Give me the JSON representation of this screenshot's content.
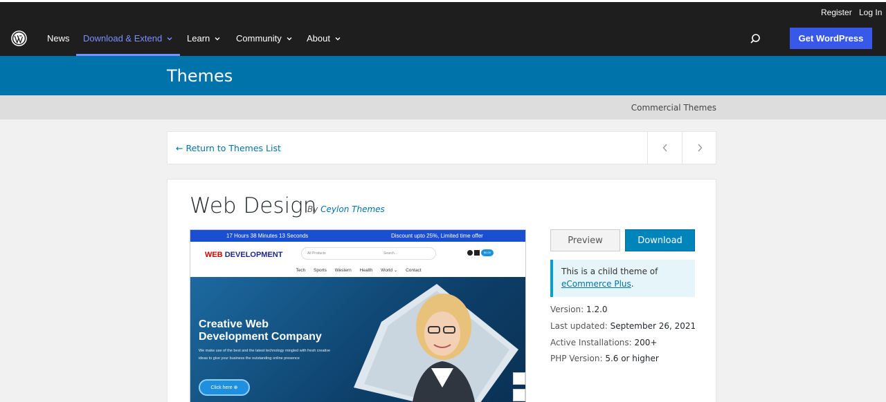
{
  "topbar": {
    "register": "Register",
    "login": "Log In"
  },
  "nav": {
    "items": [
      {
        "label": "News"
      },
      {
        "label": "Download & Extend"
      },
      {
        "label": "Learn"
      },
      {
        "label": "Community"
      },
      {
        "label": "About"
      }
    ],
    "cta": "Get WordPress",
    "accent_color": "#7b90ff",
    "cta_color": "#3858e9"
  },
  "header": {
    "title": "Themes",
    "band_color": "#0073aa"
  },
  "subnav": {
    "commercial": "Commercial Themes"
  },
  "pager": {
    "return_label": "← Return to Themes List",
    "prev_icon": "chevron-left-icon",
    "next_icon": "chevron-right-icon"
  },
  "theme": {
    "title": "Web Design",
    "by_prefix": "By",
    "author": "Ceylon Themes",
    "preview_label": "Preview",
    "download_label": "Download",
    "notice_text": "This is a child theme of",
    "notice_link": "eCommerce Plus",
    "notice_suffix": ".",
    "version_label": "Version:",
    "version": "1.2.0",
    "updated_label": "Last updated:",
    "updated": "September 26, 2021",
    "installs_label": "Active Installations:",
    "installs": "200+",
    "php_label": "PHP Version:",
    "php": "5.6 or higher"
  },
  "screenshot": {
    "timer": "17 Hours 38 Minutes 13 Seconds",
    "offer": "Discount upto 25%, Limited time offer",
    "brand_a": "WEB ",
    "brand_b": "DEVELOPMENT",
    "search_category": "All Products",
    "search_placeholder": "Search...",
    "cart_badge": "$0.00",
    "menu": [
      "Tech",
      "Sports",
      "Western",
      "Health",
      "World ⌄",
      "Contact"
    ],
    "hero_title": "Creative Web Development Company",
    "hero_text": "We make use of the best and the latest technology mingled with fresh creative ideas to give your business the outstanding online presence",
    "hero_button": "Click here ⊕"
  }
}
